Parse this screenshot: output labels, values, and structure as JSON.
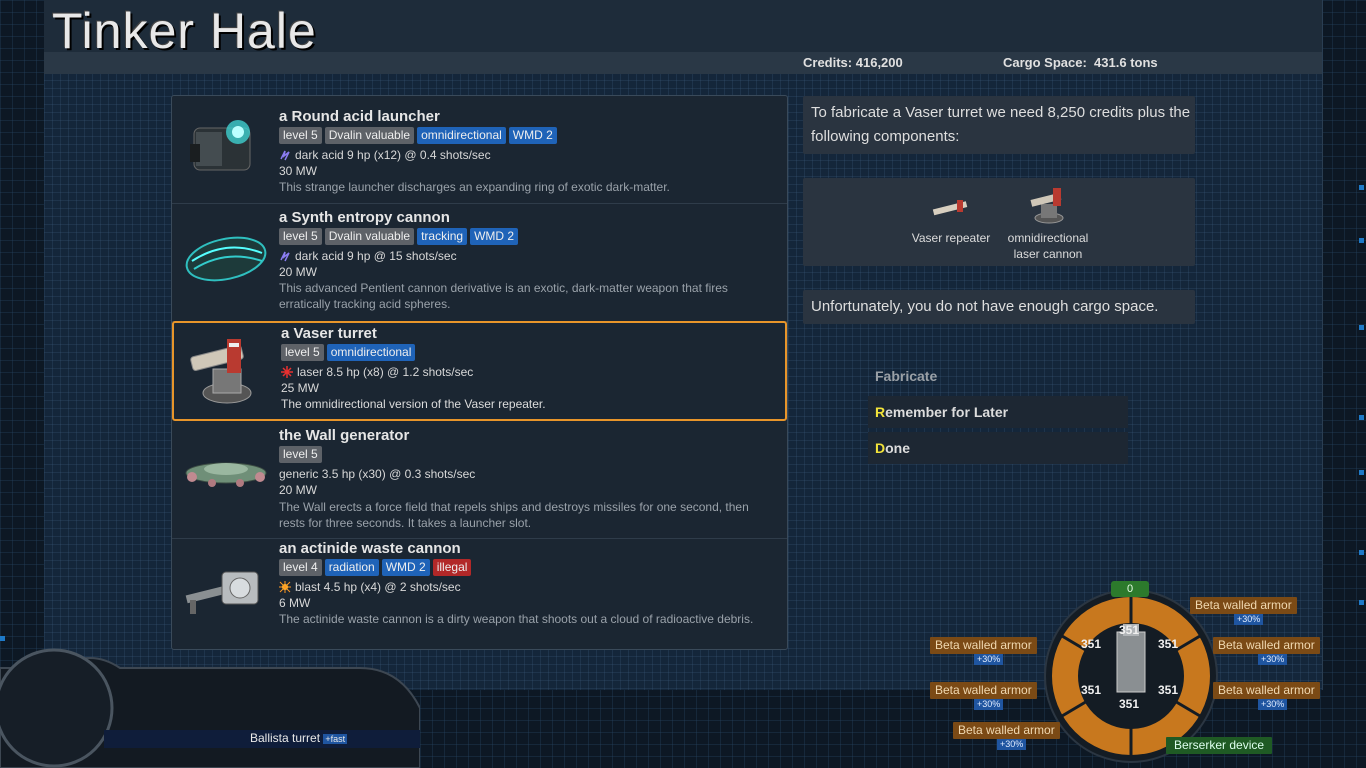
{
  "station": {
    "title": "Tinker Hale"
  },
  "stats": {
    "credits_label": "Credits:",
    "credits_value": "416,200",
    "cargo_label": "Cargo Space:",
    "cargo_value": "431.6 tons"
  },
  "items": [
    {
      "name": "a Round acid launcher",
      "tags": [
        {
          "text": "level 5",
          "style": "gray"
        },
        {
          "text": "Dvalin valuable",
          "style": "gray"
        },
        {
          "text": "omnidirectional",
          "style": "blue"
        },
        {
          "text": "WMD 2",
          "style": "blue"
        }
      ],
      "damage_icon": "dark-acid-icon",
      "damage": "dark acid 9 hp (x12) @ 0.4 shots/sec",
      "power": "30 MW",
      "desc": "This strange launcher discharges an expanding ring of exotic dark-matter."
    },
    {
      "name": "a Synth entropy cannon",
      "tags": [
        {
          "text": "level 5",
          "style": "gray"
        },
        {
          "text": "Dvalin valuable",
          "style": "gray"
        },
        {
          "text": "tracking",
          "style": "blue"
        },
        {
          "text": "WMD 2",
          "style": "blue"
        }
      ],
      "damage_icon": "dark-acid-icon",
      "damage": "dark acid 9 hp @ 15 shots/sec",
      "power": "20 MW",
      "desc": "This advanced Pentient cannon derivative is an exotic, dark-matter weapon that fires erratically tracking acid spheres."
    },
    {
      "name": "a Vaser turret",
      "tags": [
        {
          "text": "level 5",
          "style": "gray"
        },
        {
          "text": "omnidirectional",
          "style": "blue"
        }
      ],
      "damage_icon": "laser-icon",
      "damage": "laser 8.5 hp (x8) @ 1.2 shots/sec",
      "power": "25 MW",
      "desc": "The omnidirectional version of the Vaser repeater."
    },
    {
      "name": "the Wall generator",
      "tags": [
        {
          "text": "level 5",
          "style": "gray"
        }
      ],
      "damage_icon": "",
      "damage": "generic 3.5 hp (x30) @ 0.3 shots/sec",
      "power": "20 MW",
      "desc": "The Wall erects a force field that repels ships and destroys missiles for one second, then rests for three seconds. It takes a launcher slot."
    },
    {
      "name": "an actinide waste cannon",
      "tags": [
        {
          "text": "level 4",
          "style": "gray"
        },
        {
          "text": "radiation",
          "style": "blue"
        },
        {
          "text": "WMD 2",
          "style": "blue"
        },
        {
          "text": "illegal",
          "style": "red"
        }
      ],
      "damage_icon": "blast-icon",
      "damage": "blast 4.5 hp (x4) @ 2 shots/sec",
      "power": "6 MW",
      "desc": "The actinide waste cannon is a dirty weapon that shoots out a cloud of radioactive debris."
    }
  ],
  "fabricate": {
    "intro": "To fabricate a Vaser turret we need 8,250 credits plus the following components:",
    "components": [
      {
        "label_line1": "Vaser repeater",
        "label_line2": ""
      },
      {
        "label_line1": "omnidirectional",
        "label_line2": "laser cannon"
      }
    ],
    "warning": "Unfortunately, you do not have enough cargo space."
  },
  "actions": {
    "fabricate": "Fabricate",
    "remember_hotkey": "R",
    "remember_rest": "emember for Later",
    "done_hotkey": "D",
    "done_rest": "one"
  },
  "hud": {
    "weapon_label": "Ballista turret",
    "weapon_badge": "+fast",
    "shield_value": "0",
    "segments": [
      "351",
      "351",
      "351",
      "351",
      "351",
      "351"
    ],
    "armor": [
      {
        "name": "Beta walled armor",
        "bonus": "+30%"
      },
      {
        "name": "Beta walled armor",
        "bonus": "+30%"
      },
      {
        "name": "Beta walled armor",
        "bonus": "+30%"
      },
      {
        "name": "Beta walled armor",
        "bonus": "+30%"
      },
      {
        "name": "Beta walled armor",
        "bonus": "+30%"
      },
      {
        "name": "Beta walled armor",
        "bonus": "+30%"
      }
    ],
    "device": "Berserker device"
  },
  "colors": {
    "accent_selected": "#e8952a",
    "tag_blue": "#1f63b8",
    "tag_red": "#b22828",
    "hotkey": "#f2e33a",
    "armor": "#c8781e"
  }
}
